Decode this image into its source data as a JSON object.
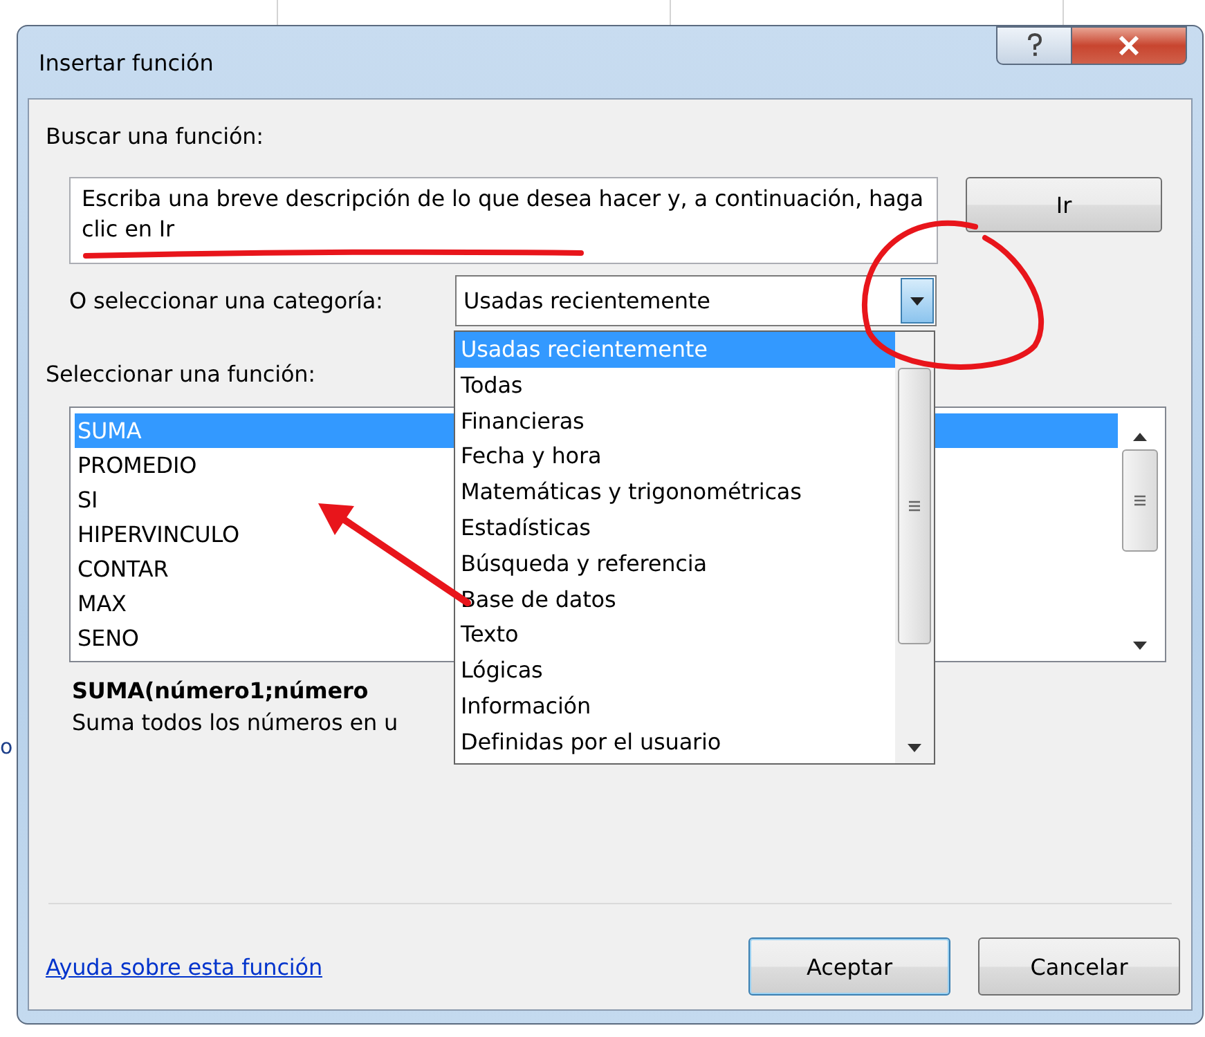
{
  "window": {
    "title": "Insertar función"
  },
  "background_cell": "o",
  "search": {
    "label": "Buscar una función:",
    "value": "Escriba una breve descripción de lo que desea hacer y, a continuación, haga clic en Ir",
    "button": "Ir"
  },
  "category": {
    "label": "O seleccionar una categoría:",
    "value": "Usadas recientemente",
    "expanded": true,
    "options": [
      {
        "label": "Usadas recientemente",
        "selected": true
      },
      {
        "label": "Todas",
        "selected": false
      },
      {
        "label": "Financieras",
        "selected": false
      },
      {
        "label": "Fecha y hora",
        "selected": false
      },
      {
        "label": "Matemáticas y trigonométricas",
        "selected": false
      },
      {
        "label": "Estadísticas",
        "selected": false
      },
      {
        "label": "Búsqueda y referencia",
        "selected": false
      },
      {
        "label": "Base de datos",
        "selected": false
      },
      {
        "label": "Texto",
        "selected": false
      },
      {
        "label": "Lógicas",
        "selected": false
      },
      {
        "label": "Información",
        "selected": false
      },
      {
        "label": "Definidas por el usuario",
        "selected": false
      }
    ]
  },
  "functions": {
    "label": "Seleccionar una función:",
    "items": [
      {
        "name": "SUMA",
        "selected": true
      },
      {
        "name": "PROMEDIO",
        "selected": false
      },
      {
        "name": "SI",
        "selected": false
      },
      {
        "name": "HIPERVINCULO",
        "selected": false
      },
      {
        "name": "CONTAR",
        "selected": false
      },
      {
        "name": "MAX",
        "selected": false
      },
      {
        "name": "SENO",
        "selected": false
      }
    ]
  },
  "signature": "SUMA(número1;número",
  "description": "Suma todos los números en u",
  "help_link": "Ayuda sobre esta función",
  "buttons": [
    {
      "label": "Aceptar",
      "default": true
    },
    {
      "label": "Cancelar",
      "default": false
    }
  ]
}
